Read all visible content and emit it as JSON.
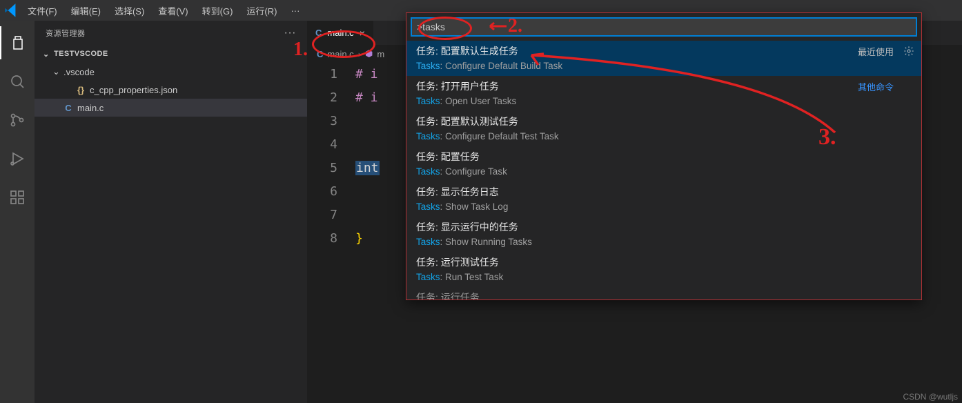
{
  "menubar": {
    "items": [
      "文件(F)",
      "编辑(E)",
      "选择(S)",
      "查看(V)",
      "转到(G)",
      "运行(R)"
    ],
    "more": "···"
  },
  "sidebar": {
    "title": "资源管理器",
    "root": "TESTVSCODE",
    "folder1": ".vscode",
    "file1": "c_cpp_properties.json",
    "file2": "main.c"
  },
  "tab": {
    "label": "main.c",
    "close": "×"
  },
  "breadcrumb": {
    "seg1": "main.c",
    "seg2": "m"
  },
  "code": {
    "line_numbers": [
      "1",
      "2",
      "3",
      "4",
      "5",
      "6",
      "7",
      "8"
    ],
    "l1": "# i",
    "l2": "# i",
    "l5": "int",
    "l8": "}"
  },
  "palette": {
    "input_value": ">tasks",
    "recent_label": "最近使用",
    "other_label": "其他命令",
    "items": [
      {
        "title_zh": "任务: 配置默认生成任务",
        "sub_prefix": "Tasks",
        "sub_rest": ": Configure Default Build Task"
      },
      {
        "title_zh": "任务: 打开用户任务",
        "sub_prefix": "Tasks",
        "sub_rest": ": Open User Tasks"
      },
      {
        "title_zh": "任务: 配置默认测试任务",
        "sub_prefix": "Tasks",
        "sub_rest": ": Configure Default Test Task"
      },
      {
        "title_zh": "任务: 配置任务",
        "sub_prefix": "Tasks",
        "sub_rest": ": Configure Task"
      },
      {
        "title_zh": "任务: 显示任务日志",
        "sub_prefix": "Tasks",
        "sub_rest": ": Show Task Log"
      },
      {
        "title_zh": "任务: 显示运行中的任务",
        "sub_prefix": "Tasks",
        "sub_rest": ": Show Running Tasks"
      },
      {
        "title_zh": "任务: 运行测试任务",
        "sub_prefix": "Tasks",
        "sub_rest": ": Run Test Task"
      }
    ],
    "cut_item": "任务: 运行任务"
  },
  "annotations": {
    "one": "1.",
    "two": "2.",
    "three": "3."
  },
  "watermark": "CSDN @wutljs"
}
